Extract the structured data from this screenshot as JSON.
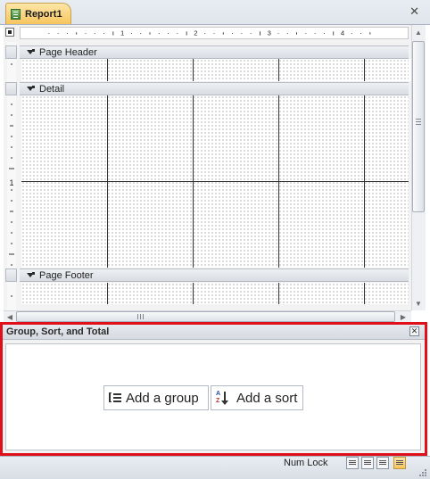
{
  "tab": {
    "title": "Report1",
    "icon": "report-icon",
    "close_glyph": "✕"
  },
  "ruler": {
    "marks": [
      "1",
      "2",
      "3",
      "4"
    ],
    "vmark": "1"
  },
  "sections": {
    "page_header": "Page Header",
    "detail": "Detail",
    "page_footer": "Page Footer"
  },
  "gst_pane": {
    "title": "Group, Sort, and Total",
    "close_glyph": "✕",
    "add_group": "Add a group",
    "add_sort": "Add a sort"
  },
  "status": {
    "num_lock": "Num Lock",
    "views": [
      "report-view-icon",
      "print-preview-icon",
      "layout-view-icon",
      "design-view-icon"
    ]
  },
  "colors": {
    "highlight_border": "#e0101a",
    "tab_active": "#f7c55e"
  }
}
